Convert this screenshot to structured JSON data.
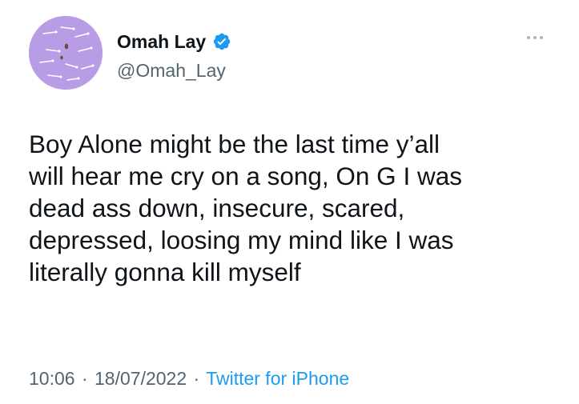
{
  "tweet": {
    "author": {
      "display_name": "Omah Lay",
      "handle": "@Omah_Lay",
      "verified": true,
      "avatar_icon": "avatar-image"
    },
    "more_icon": "more-options-icon",
    "text": "Boy Alone might be the last time y’all\nwill hear me cry on a song, On G I was\ndead ass down, insecure, scared,\ndepressed, loosing my mind like I was\nliterally gonna kill myself",
    "time": "10:06",
    "date": "18/07/2022",
    "separator": "·",
    "source": "Twitter for iPhone"
  },
  "colors": {
    "text_primary": "#0f1419",
    "text_secondary": "#536471",
    "link": "#1d9bf0",
    "verified_badge": "#1d9bf0",
    "avatar_background": "#b89ce6"
  }
}
